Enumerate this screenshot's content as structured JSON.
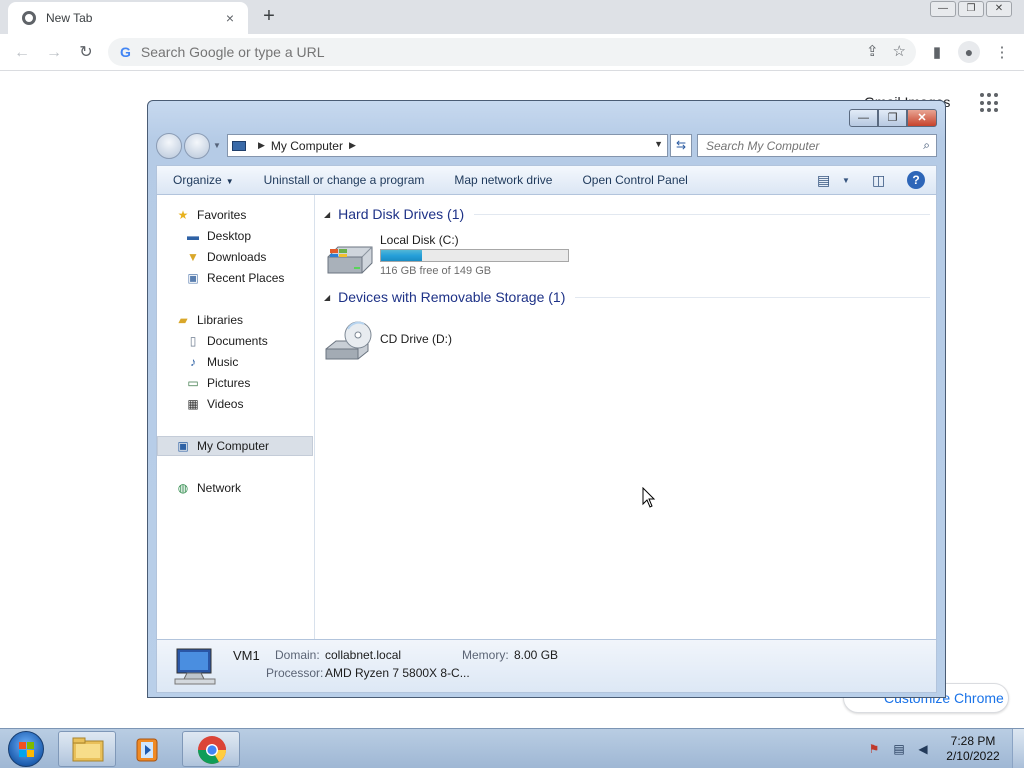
{
  "chrome": {
    "tab_title": "New Tab",
    "tab_close": "×",
    "new_tab": "+",
    "omnibox_placeholder": "Search Google or type a URL",
    "page_link_partial": "Gmail  Images",
    "customize_label": "Customize Chrome",
    "window_controls": [
      "—",
      "❐",
      "✕"
    ]
  },
  "explorer": {
    "address": {
      "location": "My Computer"
    },
    "search_placeholder": "Search My Computer",
    "commands": [
      {
        "label": "Organize",
        "has_caret": true
      },
      {
        "label": "Uninstall or change a program",
        "has_caret": false
      },
      {
        "label": "Map network drive",
        "has_caret": false
      },
      {
        "label": "Open Control Panel",
        "has_caret": false
      }
    ],
    "nav": {
      "favorites": {
        "label": "Favorites",
        "items": [
          "Desktop",
          "Downloads",
          "Recent Places"
        ]
      },
      "libraries": {
        "label": "Libraries",
        "items": [
          "Documents",
          "Music",
          "Pictures",
          "Videos"
        ]
      },
      "my_computer": "My Computer",
      "network": "Network"
    },
    "groups": [
      {
        "title": "Hard Disk Drives (1)",
        "drives": [
          {
            "name": "Local Disk (C:)",
            "free_text": "116 GB free of 149 GB",
            "used_fraction": 0.22,
            "type": "hard-disk"
          }
        ]
      },
      {
        "title": "Devices with Removable Storage (1)",
        "drives": [
          {
            "name": "CD Drive (D:)",
            "type": "cd-drive"
          }
        ]
      }
    ],
    "details": {
      "name": "VM1",
      "domain_label": "Domain:",
      "domain": "collabnet.local",
      "memory_label": "Memory:",
      "memory": "8.00 GB",
      "processor_label": "Processor:",
      "processor": "AMD Ryzen 7 5800X 8-C..."
    }
  },
  "taskbar": {
    "time": "7:28 PM",
    "date": "2/10/2022"
  },
  "colors": {
    "chrome_tabbar": "#dee1e6",
    "explorer_frame": "#b9cfe9",
    "group_header": "#1e3287",
    "drive_bar_fill": "#26a0da",
    "taskbar": "#9fb7d4"
  }
}
